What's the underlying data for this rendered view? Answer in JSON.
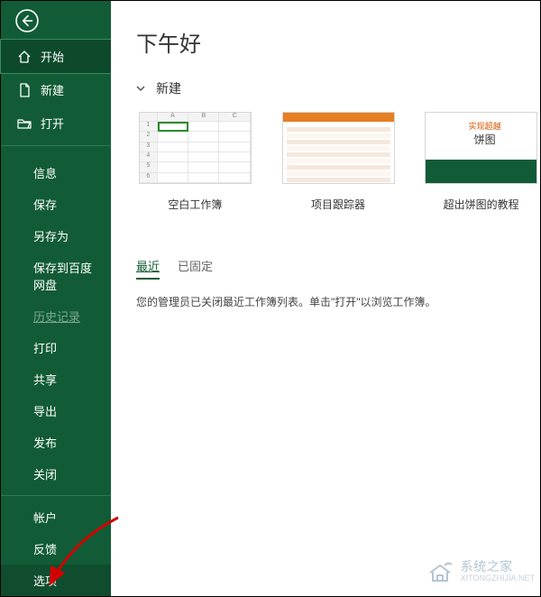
{
  "sidebar": {
    "back": "返回",
    "primary": [
      {
        "label": "开始",
        "icon": "home-icon",
        "selected": true
      },
      {
        "label": "新建",
        "icon": "new-doc-icon",
        "selected": false
      },
      {
        "label": "打开",
        "icon": "folder-open-icon",
        "selected": false
      }
    ],
    "secondary": [
      {
        "label": "信息",
        "disabled": false
      },
      {
        "label": "保存",
        "disabled": false
      },
      {
        "label": "另存为",
        "disabled": false
      },
      {
        "label": "保存到百度网盘",
        "disabled": false
      },
      {
        "label": "历史记录",
        "disabled": true
      },
      {
        "label": "打印",
        "disabled": false
      },
      {
        "label": "共享",
        "disabled": false
      },
      {
        "label": "导出",
        "disabled": false
      },
      {
        "label": "发布",
        "disabled": false
      },
      {
        "label": "关闭",
        "disabled": false
      }
    ],
    "bottom": [
      {
        "label": "帐户"
      },
      {
        "label": "反馈"
      },
      {
        "label": "选项"
      }
    ]
  },
  "main": {
    "greeting": "下午好",
    "newSection": "新建",
    "templates": [
      {
        "label": "空白工作簿",
        "type": "blank"
      },
      {
        "label": "项目跟踪器",
        "type": "tracker"
      },
      {
        "label": "超出饼图的教程",
        "type": "pie",
        "thumb_line1": "实现超越",
        "thumb_line2": "饼图"
      }
    ],
    "tabs": [
      {
        "label": "最近",
        "active": true
      },
      {
        "label": "已固定",
        "active": false
      }
    ],
    "message": "您的管理员已关闭最近工作簿列表。单击\"打开\"以浏览工作簿。"
  },
  "watermark": {
    "title": "系统之家",
    "sub": "XITONGZHIJIA.NET"
  }
}
